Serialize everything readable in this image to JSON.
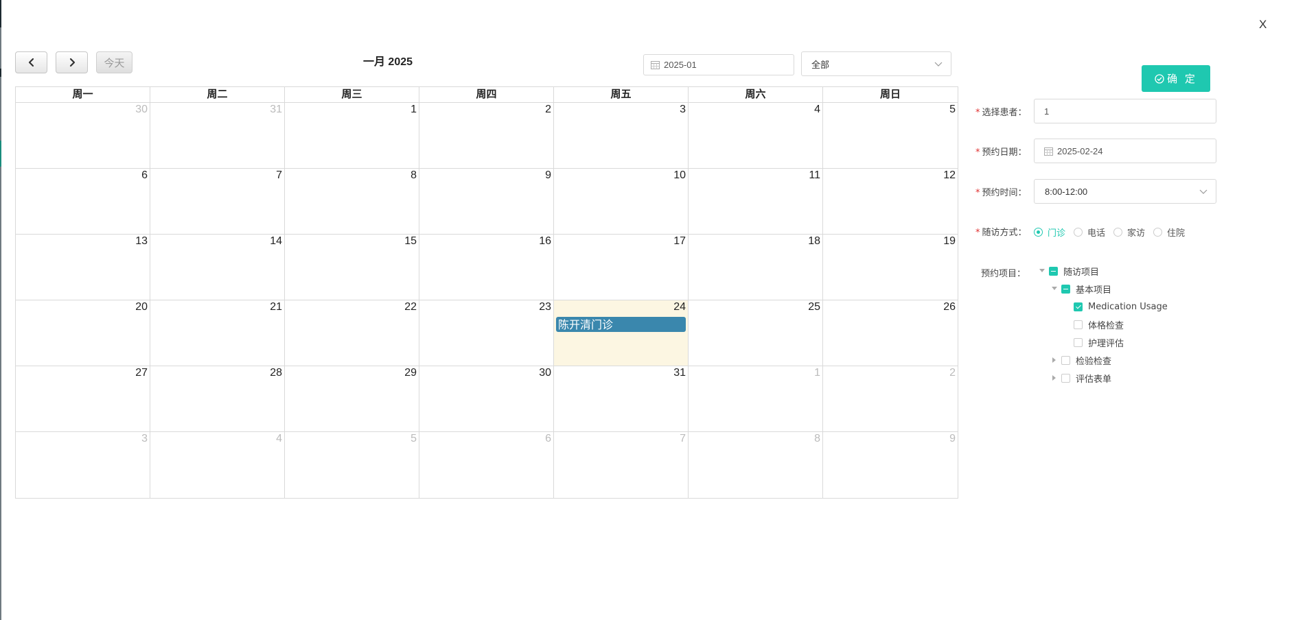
{
  "dialog": {
    "close_label": "X"
  },
  "toolbar": {
    "today_label": "今天",
    "title": "一月 2025",
    "month_value": "2025-01",
    "filter_value": "全部"
  },
  "calendar": {
    "weekdays": [
      "周一",
      "周二",
      "周三",
      "周四",
      "周五",
      "周六",
      "周日"
    ],
    "weeks": [
      [
        {
          "d": "30",
          "other": true
        },
        {
          "d": "31",
          "other": true
        },
        {
          "d": "1"
        },
        {
          "d": "2"
        },
        {
          "d": "3"
        },
        {
          "d": "4"
        },
        {
          "d": "5"
        }
      ],
      [
        {
          "d": "6"
        },
        {
          "d": "7"
        },
        {
          "d": "8"
        },
        {
          "d": "9"
        },
        {
          "d": "10"
        },
        {
          "d": "11"
        },
        {
          "d": "12"
        }
      ],
      [
        {
          "d": "13"
        },
        {
          "d": "14"
        },
        {
          "d": "15"
        },
        {
          "d": "16"
        },
        {
          "d": "17"
        },
        {
          "d": "18"
        },
        {
          "d": "19"
        }
      ],
      [
        {
          "d": "20"
        },
        {
          "d": "21"
        },
        {
          "d": "22"
        },
        {
          "d": "23"
        },
        {
          "d": "24",
          "today": true,
          "event": "陈开清门诊"
        },
        {
          "d": "25"
        },
        {
          "d": "26"
        }
      ],
      [
        {
          "d": "27"
        },
        {
          "d": "28"
        },
        {
          "d": "29"
        },
        {
          "d": "30"
        },
        {
          "d": "31"
        },
        {
          "d": "1",
          "other": true
        },
        {
          "d": "2",
          "other": true
        }
      ],
      [
        {
          "d": "3",
          "other": true
        },
        {
          "d": "4",
          "other": true
        },
        {
          "d": "5",
          "other": true
        },
        {
          "d": "6",
          "other": true
        },
        {
          "d": "7",
          "other": true
        },
        {
          "d": "8",
          "other": true
        },
        {
          "d": "9",
          "other": true
        }
      ]
    ],
    "event_color": "#3a87ad",
    "today_bg": "#fcf6e2"
  },
  "form": {
    "confirm_label": "确 定",
    "patient": {
      "label": "选择患者：",
      "value": "1"
    },
    "date": {
      "label": "预约日期：",
      "value": "2025-02-24"
    },
    "time": {
      "label": "预约时间：",
      "value": "8:00-12:00"
    },
    "method": {
      "label": "随访方式：",
      "options": [
        "门诊",
        "电话",
        "家访",
        "住院"
      ],
      "selected": "门诊"
    },
    "items": {
      "label": "预约项目：",
      "tree": [
        {
          "label": "随访项目",
          "level": 0,
          "state": "indeterminate",
          "arrow": "down"
        },
        {
          "label": "基本项目",
          "level": 1,
          "state": "indeterminate",
          "arrow": "down"
        },
        {
          "label": "Medication Usage",
          "level": 2,
          "state": "checked",
          "arrow": "none"
        },
        {
          "label": "体格检查",
          "level": 2,
          "state": "unchecked",
          "arrow": "none"
        },
        {
          "label": "护理评估",
          "level": 2,
          "state": "unchecked",
          "arrow": "none"
        },
        {
          "label": "检验检查",
          "level": 1,
          "state": "unchecked",
          "arrow": "right"
        },
        {
          "label": "评估表单",
          "level": 1,
          "state": "unchecked",
          "arrow": "right"
        }
      ]
    },
    "accent_color": "#1fc8b0"
  }
}
